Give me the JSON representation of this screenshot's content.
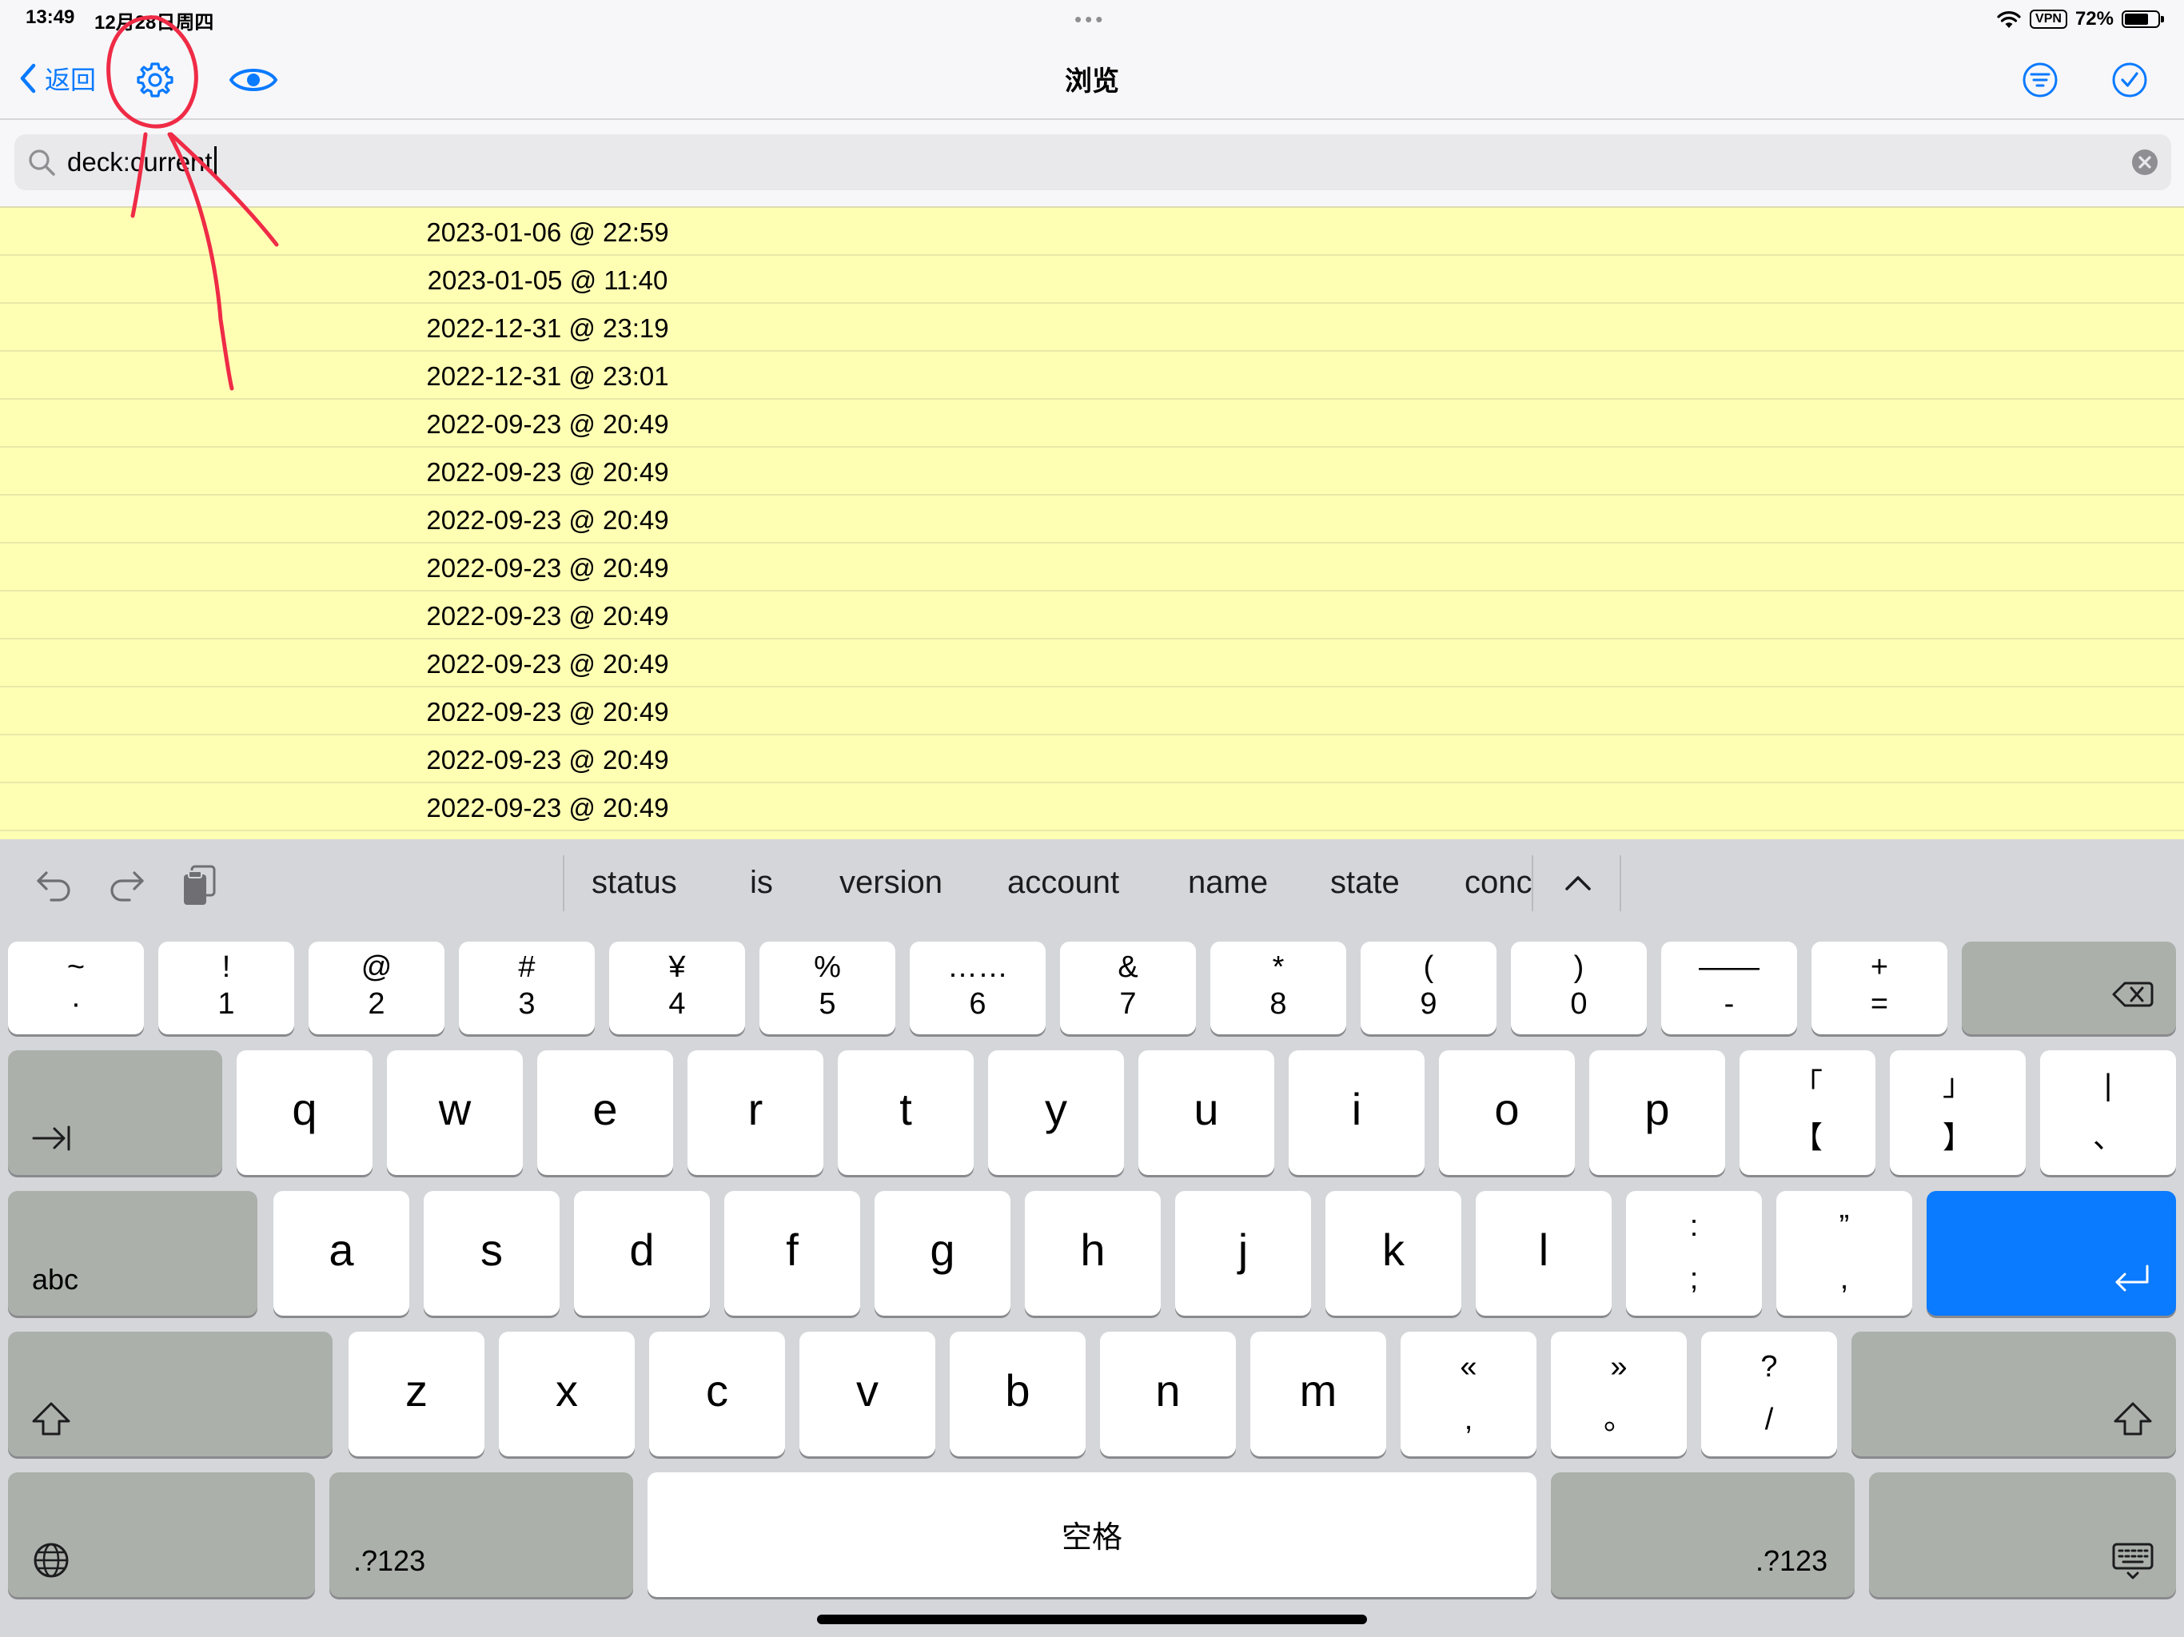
{
  "status_bar": {
    "time": "13:49",
    "date": "12月28日周四",
    "vpn": "VPN",
    "battery": "72%",
    "battery_level": 0.72
  },
  "nav": {
    "back_label": "返回",
    "title": "浏览",
    "accent_color": "#0a7aff",
    "icons": [
      "chevron-left-icon",
      "gear-icon",
      "eye-icon",
      "filter-icon",
      "checkmark-circle-icon"
    ]
  },
  "search": {
    "value": "deck:current"
  },
  "cards": {
    "row_color": "#ffffb4",
    "rows": [
      "2023-01-06 @ 22:59",
      "2023-01-05 @ 11:40",
      "2022-12-31 @ 23:19",
      "2022-12-31 @ 23:01",
      "2022-09-23 @ 20:49",
      "2022-09-23 @ 20:49",
      "2022-09-23 @ 20:49",
      "2022-09-23 @ 20:49",
      "2022-09-23 @ 20:49",
      "2022-09-23 @ 20:49",
      "2022-09-23 @ 20:49",
      "2022-09-23 @ 20:49",
      "2022-09-23 @ 20:49"
    ]
  },
  "keyboard": {
    "suggestions": [
      "status",
      "is",
      "version",
      "account",
      "name",
      "state",
      "conc"
    ],
    "number_row": [
      {
        "top": "~",
        "bottom": "·"
      },
      {
        "top": "!",
        "bottom": "1"
      },
      {
        "top": "@",
        "bottom": "2"
      },
      {
        "top": "#",
        "bottom": "3"
      },
      {
        "top": "¥",
        "bottom": "4"
      },
      {
        "top": "%",
        "bottom": "5"
      },
      {
        "top": "……",
        "bottom": "6"
      },
      {
        "top": "&",
        "bottom": "7"
      },
      {
        "top": "*",
        "bottom": "8"
      },
      {
        "top": "(",
        "bottom": "9"
      },
      {
        "top": ")",
        "bottom": "0"
      },
      {
        "top": "——",
        "bottom": "-"
      },
      {
        "top": "+",
        "bottom": "="
      }
    ],
    "row_q": [
      "q",
      "w",
      "e",
      "r",
      "t",
      "y",
      "u",
      "i",
      "o",
      "p"
    ],
    "row_q_punct": [
      {
        "top": "「",
        "bottom": "【"
      },
      {
        "top": "」",
        "bottom": "】"
      },
      {
        "top": "|",
        "bottom": "、"
      }
    ],
    "row_a": [
      "a",
      "s",
      "d",
      "f",
      "g",
      "h",
      "j",
      "k",
      "l"
    ],
    "row_a_punct": [
      {
        "top": ":",
        "bottom": ";"
      },
      {
        "top": "”",
        "bottom": ","
      }
    ],
    "row_z": [
      "z",
      "x",
      "c",
      "v",
      "b",
      "n",
      "m"
    ],
    "row_z_punct": [
      {
        "top": "«",
        "bottom": ","
      },
      {
        "top": "»",
        "bottom": "。"
      },
      {
        "top": "?",
        "bottom": "/"
      }
    ],
    "abc_label": "abc",
    "numbers_label": ".?123",
    "space_label": "空格",
    "return_color": "#0a7aff"
  }
}
